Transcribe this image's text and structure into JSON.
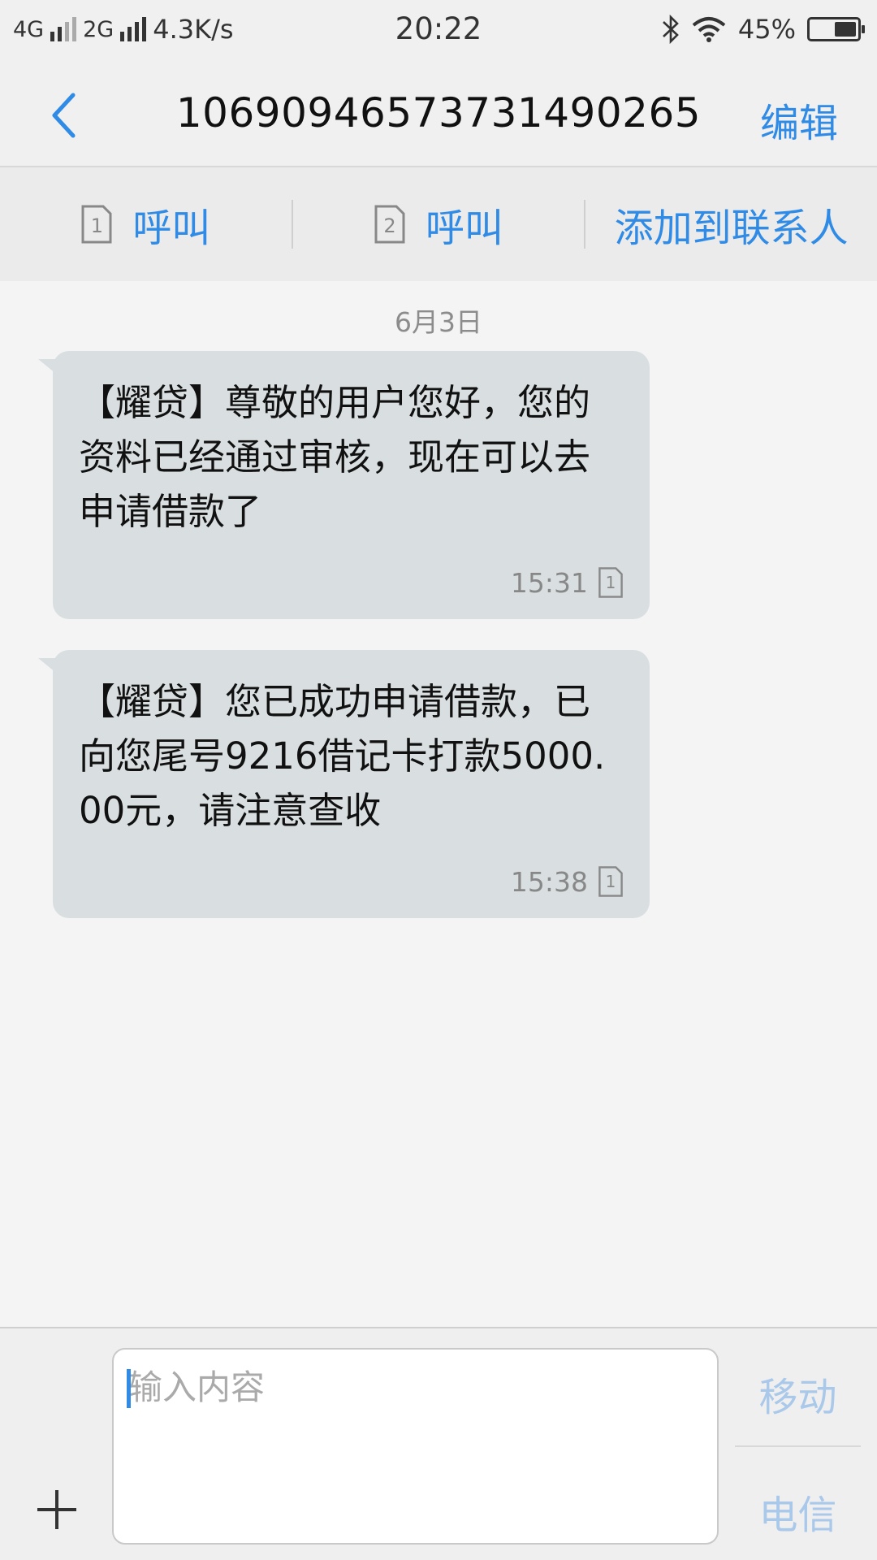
{
  "status_bar": {
    "net1": "4G",
    "net2": "2G",
    "speed": "4.3K/s",
    "time": "20:22",
    "battery": "45%"
  },
  "header": {
    "title": "106909465737314902​65",
    "edit_label": "编辑"
  },
  "actions": {
    "call1_label": "呼叫",
    "call1_sim": "1",
    "call2_label": "呼叫",
    "call2_sim": "2",
    "add_contact_label": "添加到联系人"
  },
  "conversation": {
    "date": "6月3日",
    "messages": [
      {
        "text": "【耀贷】尊敬的用户您好，您的资料已经通过审核，现在可以去申请借款了",
        "time": "15:31",
        "sim": "1"
      },
      {
        "text": "【耀贷】您已成功申请借款，已向您尾号9216借记卡打款5000.00元，请注意查收",
        "time": "15:38",
        "sim": "1"
      }
    ]
  },
  "composer": {
    "placeholder": "输入内容",
    "send_sim1_label": "移动",
    "send_sim2_label": "电信"
  },
  "colors": {
    "accent": "#2f8be6",
    "bubble": "#d9dfe1",
    "background": "#f4f4f4",
    "send_disabled": "#a9c8ea"
  }
}
